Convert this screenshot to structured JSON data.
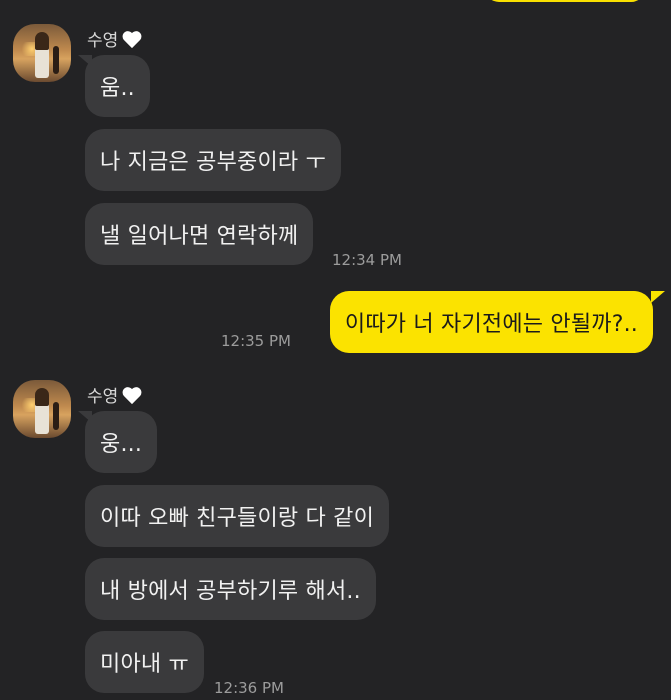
{
  "chat": {
    "contact_name": "수영",
    "heart_icon": "white-heart-icon",
    "avatar_icon": "profile-avatar",
    "colors": {
      "background": "#232325",
      "incoming": "#3a3a3c",
      "outgoing": "#fbe300",
      "time": "#9c9c9c"
    },
    "group1": {
      "messages": [
        "움..",
        "나 지금은 공부중이라 ㅜ",
        "낼 일어나면 연락하께"
      ],
      "time": "12:34 PM"
    },
    "outgoing": {
      "message": "이따가 너 자기전에는 안될까?..",
      "time": "12:35 PM"
    },
    "group2": {
      "messages": [
        "웅...",
        "이따 오빠 친구들이랑 다 같이",
        "내 방에서 공부하기루 해서..",
        "미아내 ㅠ"
      ],
      "time": "12:36 PM"
    }
  }
}
